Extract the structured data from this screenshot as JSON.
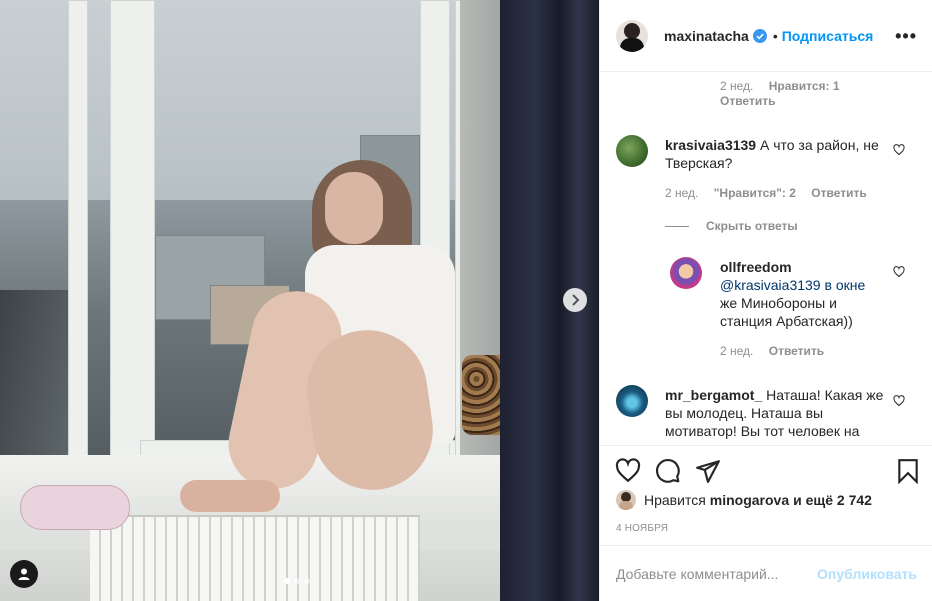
{
  "post": {
    "author": "maxinatacha",
    "follow_label": "Подписаться",
    "separator": "•",
    "more_label": "•••",
    "carousel_dots": 3,
    "carousel_active": 0
  },
  "comments": [
    {
      "type": "meta_only",
      "time": "2 нед.",
      "likes": "Нравится: 1",
      "reply": "Ответить"
    },
    {
      "username": "krasivaia3139",
      "text_line1": "А что за район, не",
      "text_line2": "Тверская?",
      "time": "2 нед.",
      "likes": "\"Нравится\": 2",
      "reply": "Ответить",
      "hide_replies": "Скрыть ответы"
    },
    {
      "username": "ollfreedom",
      "line1": "@krasivaia3139 в окне",
      "line2": "же Минобороны и",
      "line3": "станция Арбатская))",
      "time": "2 нед.",
      "reply": "Ответить"
    },
    {
      "username": "mr_bergamot_",
      "text_line1": "Наташа! Какая же",
      "line2": "вы молодец. Наташа вы",
      "line3": "мотиватор! Вы тот человек на"
    }
  ],
  "likes": {
    "prefix": "Нравится",
    "user": "minogarova",
    "suffix": "и ещё 2 742"
  },
  "date": "4 ноября",
  "add_comment": {
    "placeholder": "Добавьте комментарий...",
    "publish": "Опубликовать"
  },
  "colors": {
    "accent": "#0095f6",
    "publish_disabled": "#b2dffc",
    "muted": "#8e8e8e",
    "text": "#262626"
  }
}
